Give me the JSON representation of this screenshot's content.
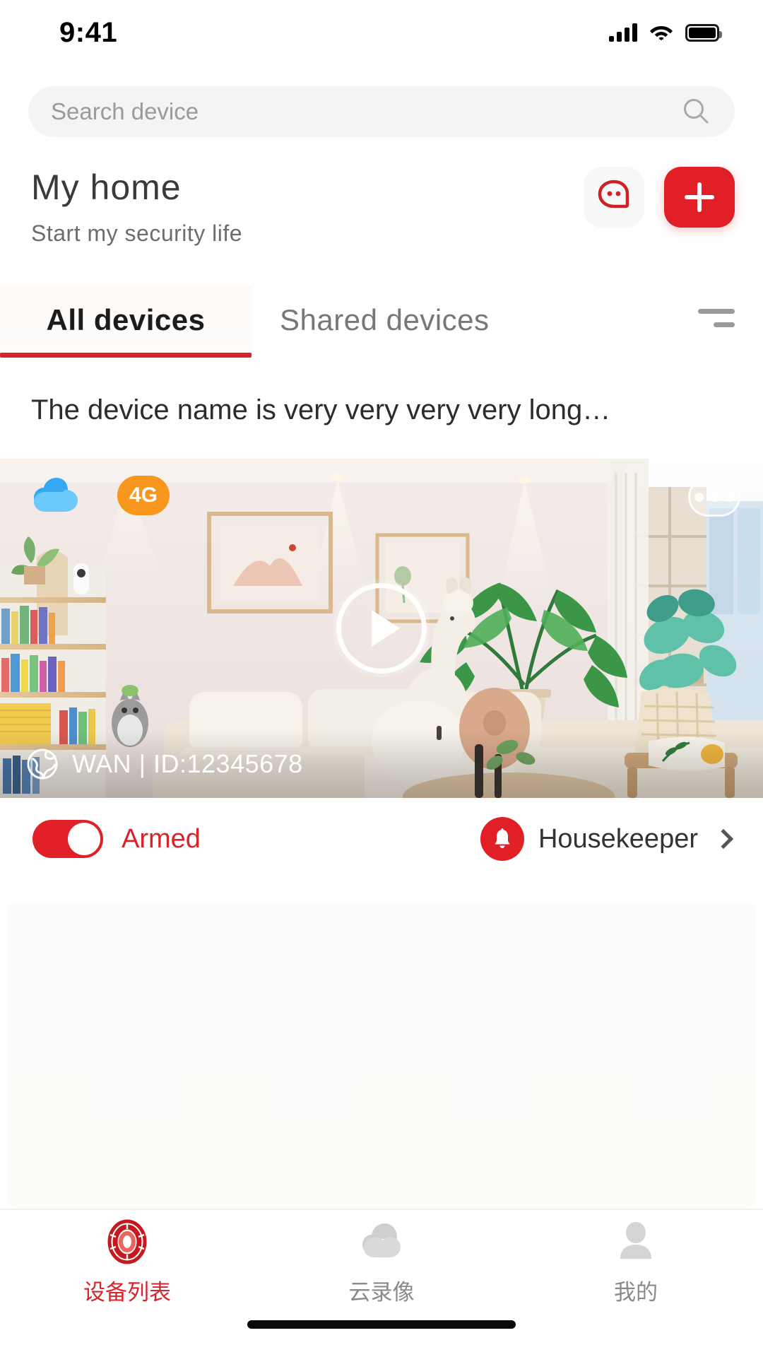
{
  "status_bar": {
    "time": "9:41",
    "signal_icon": "cellular-signal-icon",
    "wifi_icon": "wifi-icon",
    "battery_icon": "battery-full-icon"
  },
  "search": {
    "placeholder": "Search device",
    "value": "",
    "icon": "search-icon"
  },
  "header": {
    "title": "My home",
    "subtitle": "Start my security life",
    "chat_icon": "chat-bubble-icon",
    "add_icon": "plus-icon"
  },
  "tabs": {
    "items": [
      {
        "label": "All devices",
        "active": true
      },
      {
        "label": "Shared devices",
        "active": false
      }
    ],
    "filter_icon": "filter-sort-icon"
  },
  "device": {
    "name": "The device name is very very very very long…",
    "cloud_badge": "cloud-icon",
    "network_badge": "4G",
    "more_icon": "more-horizontal-icon",
    "play_icon": "play-icon",
    "connection_icon": "globe-icon",
    "connection_text": "WAN | ID:12345678",
    "armed": {
      "label": "Armed",
      "enabled": true
    },
    "housekeeper": {
      "label": "Housekeeper",
      "icon": "bell-icon",
      "chevron": "chevron-right-icon"
    }
  },
  "bottom_nav": {
    "items": [
      {
        "label": "设备列表",
        "icon": "device-list-icon",
        "active": true
      },
      {
        "label": "云录像",
        "icon": "cloud-recording-icon",
        "active": false
      },
      {
        "label": "我的",
        "icon": "profile-icon",
        "active": false
      }
    ]
  },
  "colors": {
    "brand_red": "#e01f26",
    "accent_red": "#d8242b",
    "orange_badge": "#f7971e",
    "cloud_blue": "#3fb5f5"
  }
}
